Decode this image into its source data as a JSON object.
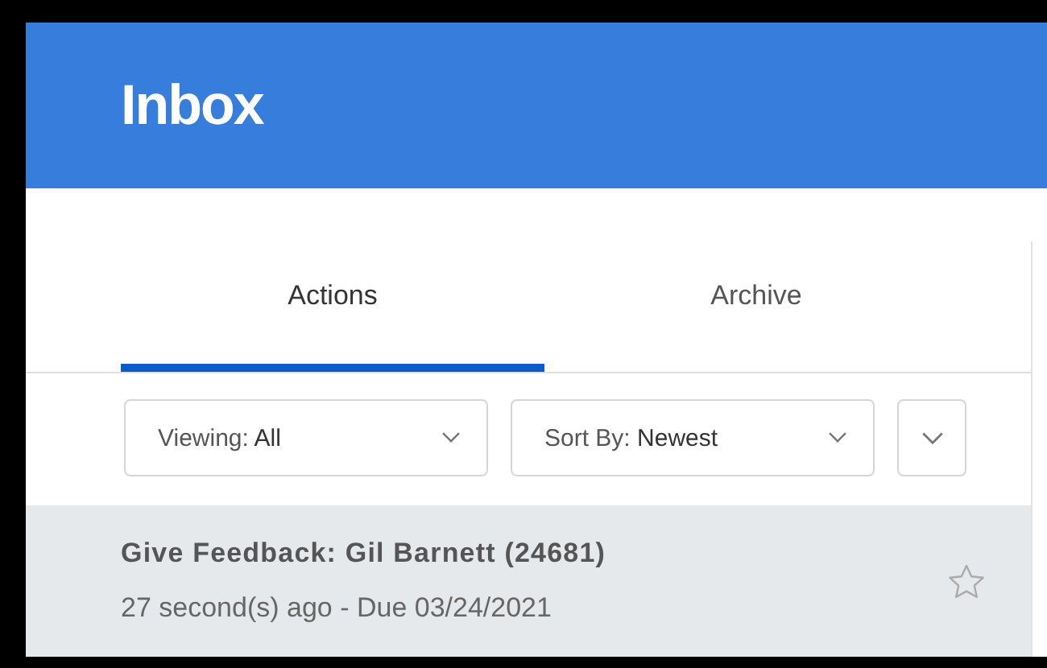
{
  "header": {
    "title": "Inbox"
  },
  "tabs": [
    {
      "label": "Actions",
      "selected": true
    },
    {
      "label": "Archive",
      "selected": false
    }
  ],
  "filters": [
    {
      "text": "Viewing: **All**"
    },
    {
      "text": "Sort By: **Newest**"
    }
  ],
  "items": [
    {
      "title": "Give Feedback: Gil Barnett (24681)",
      "meta": "27 second(s) ago - Due 03/24/2021",
      "starred": false
    }
  ]
}
